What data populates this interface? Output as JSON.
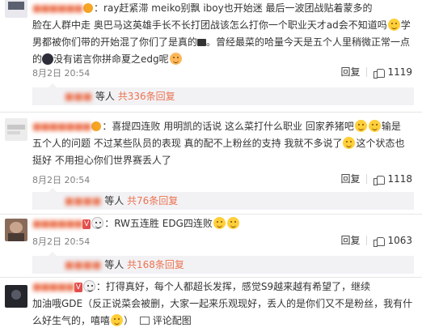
{
  "comments": [
    {
      "user": "■■■■■■",
      "text_1": "：ray赶紧滞 meiko别飘 iboy也开始迷 最后一波团战贴着蒙多的",
      "text_2": "脸在人群中走 奥巴马这英雄手长不长打团战该怎么打你一个职业天才ad会不知道吗",
      "text_3": "学",
      "text_4": "男都被你们带的开始混了你们了是真的",
      "text_5": "。曾经最菜的哈量今天是五个人里稍微正常一点",
      "text_6": "的",
      "text_7": "没有诺言你拼命夏之edg呢",
      "time": "8月2日 20:54",
      "reply_label": "回复",
      "likes": "1119",
      "replies_prefix": "等人",
      "replies_count": "共336条回复"
    },
    {
      "user": "■■■■■■■",
      "text_1": "：喜提四连败 用明凯的话说 这么菜打什么职业 回家养猪吧",
      "text_2": "输是",
      "text_3": "五个人的问题 不过某些队员的表现 真的配不上粉丝的支持 我就不多说了",
      "text_4": "这个状态也",
      "text_5": "挺好 不用担心你们世界赛丢人了",
      "time": "8月2日 20:54",
      "reply_label": "回复",
      "likes": "1118",
      "replies_prefix": "等人",
      "replies_count": "共76条回复"
    },
    {
      "user": "■■■■■■",
      "text_1": "：RW五连胜 EDG四连败",
      "time": "8月2日 20:54",
      "reply_label": "回复",
      "likes": "1063",
      "replies_prefix": "等人",
      "replies_count": "共168条回复"
    },
    {
      "user": "■■■■■",
      "text_1": "：打得真好，每个人都超长发挥，感觉S9越来越有希望了，继续",
      "text_2": "加油哦GDE（反正说菜会被删，大家一起来乐观现好，丢人的是你们又不是粉丝，我有什",
      "text_3": "么好生气的，嘻嘻",
      "text_4": "）",
      "time": "8月2日 20:54",
      "reply_label": "评论配图"
    }
  ],
  "colors": {
    "accent": "#eb7350",
    "text": "#333333",
    "muted": "#808080",
    "reply_bg": "#f2f2f5"
  },
  "icons": [
    "like-icon",
    "emoji-icon",
    "vip-badge-icon",
    "image-icon"
  ]
}
